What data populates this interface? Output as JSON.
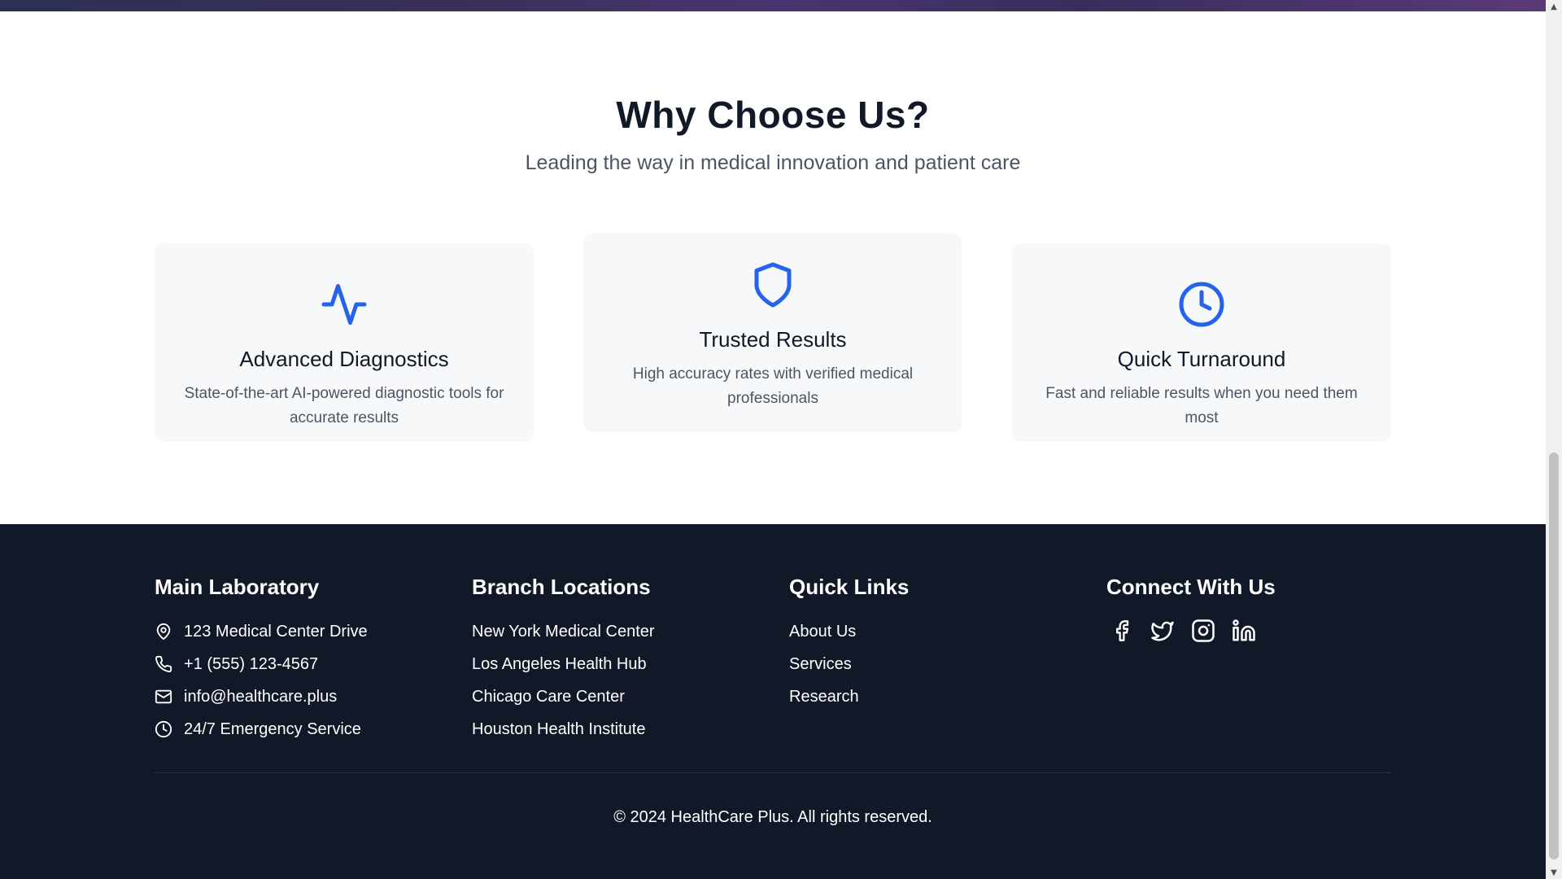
{
  "why": {
    "title": "Why Choose Us?",
    "subtitle": "Leading the way in medical innovation and patient care",
    "cards": [
      {
        "icon": "activity-icon",
        "title": "Advanced Diagnostics",
        "desc": "State-of-the-art AI-powered diagnostic tools for accurate results"
      },
      {
        "icon": "shield-icon",
        "title": "Trusted Results",
        "desc": "High accuracy rates with verified medical professionals"
      },
      {
        "icon": "clock-icon",
        "title": "Quick Turnaround",
        "desc": "Fast and reliable results when you need them most"
      }
    ],
    "accent_color": "#2563eb"
  },
  "footer": {
    "main_lab": {
      "title": "Main Laboratory",
      "items": [
        {
          "icon": "map-pin-icon",
          "text": "123 Medical Center Drive"
        },
        {
          "icon": "phone-icon",
          "text": "+1 (555) 123-4567"
        },
        {
          "icon": "mail-icon",
          "text": "info@healthcare.plus"
        },
        {
          "icon": "clock-icon",
          "text": "24/7 Emergency Service"
        }
      ]
    },
    "branches": {
      "title": "Branch Locations",
      "items": [
        "New York Medical Center",
        "Los Angeles Health Hub",
        "Chicago Care Center",
        "Houston Health Institute"
      ]
    },
    "quick_links": {
      "title": "Quick Links",
      "items": [
        "About Us",
        "Services",
        "Research"
      ]
    },
    "connect": {
      "title": "Connect With Us",
      "icons": [
        "facebook-icon",
        "twitter-icon",
        "instagram-icon",
        "linkedin-icon"
      ]
    },
    "copyright": "© 2024 HealthCare Plus. All rights reserved.",
    "background_color": "#111827"
  }
}
